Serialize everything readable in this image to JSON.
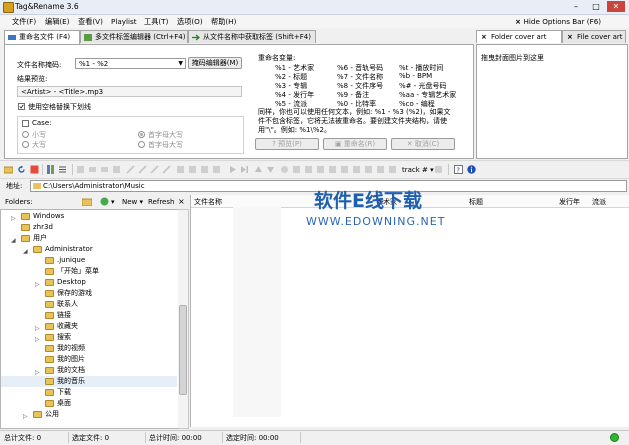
{
  "window": {
    "title": "Tag&Rename 3.6",
    "minimize": "–",
    "maximize": "□",
    "close": "✕"
  },
  "menu": [
    "文件(F)",
    "编辑(E)",
    "查看(V)",
    "Playlist",
    "工具(T)",
    "选项(O)",
    "帮助(H)"
  ],
  "hide_options": "Hide Options Bar (F6)",
  "tabs": [
    {
      "label": "重命名文件 (F4)"
    },
    {
      "label": "多文件标签编辑器 (Ctrl+F4)"
    },
    {
      "label": "从文件名称中获取标签 (Shift+F4)"
    }
  ],
  "right_tabs": [
    {
      "label": "Folder cover art"
    },
    {
      "label": "File cover art"
    }
  ],
  "cover_hint": "拖曳封面图片到这里",
  "rename": {
    "mask_label": "文件名称掩码:",
    "mask_value": "%1 - %2",
    "mask_editor": "掩码编辑器(M)",
    "preview_label": "结果预览:",
    "preview_value": "<Artist> - <Title>.mp3",
    "underscore": "使用空格替换下划线",
    "case_label": "Case:",
    "case_options": [
      "小写",
      "首字母大写",
      "大写",
      "首字母大写"
    ],
    "vars_title": "重命名变量:",
    "vars": [
      [
        "%1 - 艺术家",
        "%6 - 音轨号码",
        "%t - 播放时间"
      ],
      [
        "%2 - 标题",
        "%7 - 文件名称",
        "%b - BPM"
      ],
      [
        "%3 - 专辑",
        "%8 - 文件序号",
        "%# - 光盘号码"
      ],
      [
        "%4 - 发行年",
        "%9 - 备注",
        "%aa - 专辑艺术家"
      ],
      [
        "%5 - 流派",
        "%0 - 比特率",
        "%co - 编程"
      ]
    ],
    "note1": "同样，你也可以使用任何文本，例如: %1 - %3 (%2)，如果文",
    "note2": "件不包含标签，它将无法被重命名。要创建文件夹结构，请使",
    "note3": "用\"\\\"。例如: %1\\%2。",
    "btn_preview": "预览(P)",
    "btn_rename": "重命名(R)",
    "btn_cancel": "取消(C)"
  },
  "toolbar": {
    "track_label": "track #"
  },
  "address": {
    "label": "地址:",
    "value": "C:\\Users\\Administrator\\Music"
  },
  "folders": {
    "label": "Folders:",
    "new": "New",
    "refresh": "Refresh"
  },
  "tree": [
    {
      "label": "Windows",
      "indent": 1,
      "exp": "▷"
    },
    {
      "label": "zhr3d",
      "indent": 1,
      "exp": ""
    },
    {
      "label": "用户",
      "indent": 1,
      "exp": "◢"
    },
    {
      "label": "Administrator",
      "indent": 2,
      "exp": "◢"
    },
    {
      "label": ".junique",
      "indent": 3,
      "exp": ""
    },
    {
      "label": "「开始」菜单",
      "indent": 3,
      "exp": ""
    },
    {
      "label": "Desktop",
      "indent": 3,
      "exp": "▷"
    },
    {
      "label": "保存的游戏",
      "indent": 3,
      "exp": ""
    },
    {
      "label": "联系人",
      "indent": 3,
      "exp": ""
    },
    {
      "label": "链接",
      "indent": 3,
      "exp": ""
    },
    {
      "label": "收藏夹",
      "indent": 3,
      "exp": "▷"
    },
    {
      "label": "搜索",
      "indent": 3,
      "exp": "▷"
    },
    {
      "label": "我的视频",
      "indent": 3,
      "exp": ""
    },
    {
      "label": "我的图片",
      "indent": 3,
      "exp": ""
    },
    {
      "label": "我的文档",
      "indent": 3,
      "exp": "▷"
    },
    {
      "label": "我的音乐",
      "indent": 3,
      "exp": ""
    },
    {
      "label": "下载",
      "indent": 3,
      "exp": ""
    },
    {
      "label": "桌面",
      "indent": 3,
      "exp": ""
    },
    {
      "label": "公用",
      "indent": 2,
      "exp": "▷"
    }
  ],
  "columns": [
    "文件名称",
    "艺术家",
    "标题",
    "发行年",
    "流派"
  ],
  "watermark": {
    "cn": "软件E线下载",
    "url": "WWW.EDOWNING.NET"
  },
  "status": {
    "total_files": "总计文件: 0",
    "selected_files": "选定文件: 0",
    "total_time": "总计时间: 00:00",
    "selected_time": "选定时间: 00:00"
  }
}
